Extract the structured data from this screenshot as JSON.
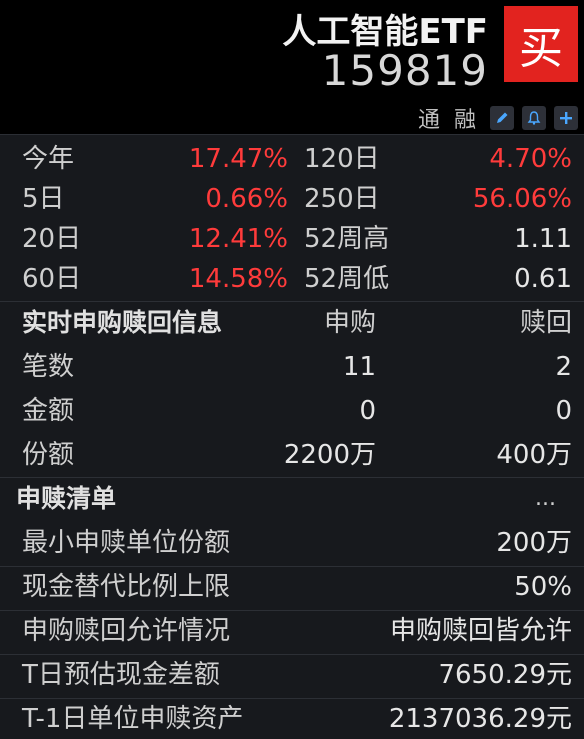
{
  "header": {
    "title": "人工智能ETF",
    "code": "159819",
    "buy_label": "买",
    "flags": [
      "通",
      "融"
    ],
    "icons": [
      "edit-icon",
      "bell-icon",
      "add-icon"
    ]
  },
  "performance": [
    {
      "label_left": "今年",
      "value_left": "17.47%",
      "label_right": "120日",
      "value_right": "4.70%"
    },
    {
      "label_left": "5日",
      "value_left": "0.66%",
      "label_right": "250日",
      "value_right": "56.06%"
    },
    {
      "label_left": "20日",
      "value_left": "12.41%",
      "label_right": "52周高",
      "value_right": "1.11"
    },
    {
      "label_left": "60日",
      "value_left": "14.58%",
      "label_right": "52周低",
      "value_right": "0.61"
    }
  ],
  "realtime": {
    "title": "实时申购赎回信息",
    "col_subscribe": "申购",
    "col_redeem": "赎回",
    "rows": [
      {
        "label": "笔数",
        "subscribe": "11",
        "redeem": "2"
      },
      {
        "label": "金额",
        "subscribe": "0",
        "redeem": "0"
      },
      {
        "label": "份额",
        "subscribe": "2200万",
        "redeem": "400万"
      }
    ]
  },
  "list": {
    "title": "申赎清单",
    "more": "...",
    "rows": [
      {
        "label": "最小申赎单位份额",
        "value": "200万"
      },
      {
        "label": "现金替代比例上限",
        "value": "50%"
      },
      {
        "label": "申购赎回允许情况",
        "value": "申购赎回皆允许"
      },
      {
        "label": "T日预估现金差额",
        "value": "7650.29元"
      },
      {
        "label": "T-1日单位申赎资产",
        "value": "2137036.29元"
      }
    ]
  },
  "colors": {
    "up": "#ff3b3b",
    "buy": "#e2231f",
    "accent": "#4aa7ff",
    "background": "#17191d"
  }
}
